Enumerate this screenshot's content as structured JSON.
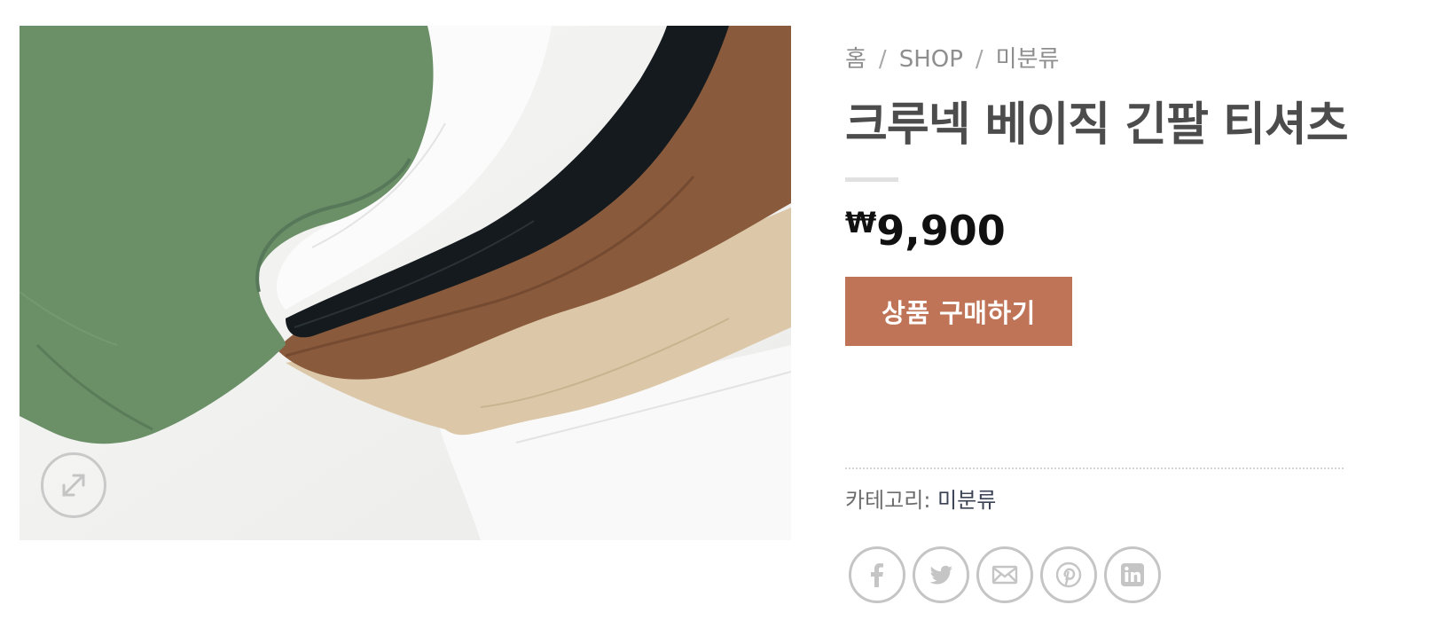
{
  "gallery": {
    "image_alt": "",
    "zoom_icon": "expand-arrows-icon"
  },
  "breadcrumb": {
    "home": "홈",
    "shop": "SHOP",
    "category": "미분류",
    "separator": "/"
  },
  "product": {
    "title": "크루넥 베이직 긴팔 티셔츠",
    "currency_symbol": "₩",
    "price": "9,900",
    "buy_label": "상품 구매하기"
  },
  "meta": {
    "category_label": "카테고리:",
    "category_value": "미분류"
  },
  "share": {
    "icons": [
      "facebook-icon",
      "twitter-icon",
      "email-icon",
      "pinterest-icon",
      "linkedin-icon"
    ]
  },
  "colors": {
    "button": "#c07457",
    "title": "#4c4c4c",
    "breadcrumb": "#8e8e8e",
    "icon_border": "#c5c5c5"
  }
}
